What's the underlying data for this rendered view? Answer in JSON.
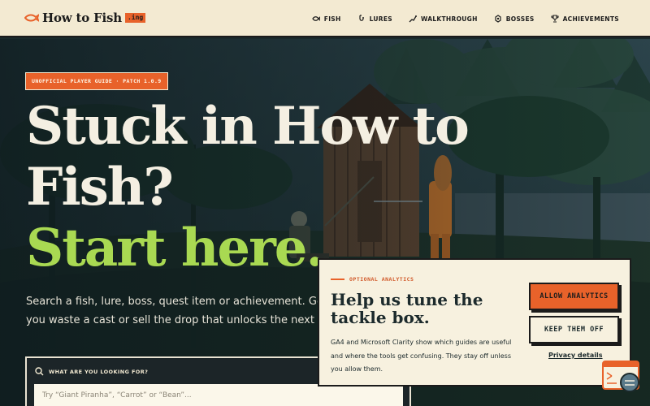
{
  "header": {
    "logo_text": "How to Fish",
    "logo_tld": ".ing",
    "nav": [
      {
        "label": "FISH",
        "icon": "fish-icon"
      },
      {
        "label": "LURES",
        "icon": "lure-icon"
      },
      {
        "label": "WALKTHROUGH",
        "icon": "path-icon"
      },
      {
        "label": "BOSSES",
        "icon": "boss-icon"
      },
      {
        "label": "ACHIEVEMENTS",
        "icon": "trophy-icon"
      }
    ]
  },
  "hero": {
    "badge": "UNOFFICIAL PLAYER GUIDE · PATCH 1.0.9",
    "title_line1": "Stuck in How to",
    "title_line2": "Fish?",
    "title_line3": "Start here.",
    "subtitle_line1": "Search a fish, lure, boss, quest item or achievement. Get the answer",
    "subtitle_line2": "you waste a cast or sell the drop that unlocks the next island.",
    "search_label": "WHAT ARE YOU LOOKING FOR?",
    "search_placeholder": "Try “Giant Piranha”, “Carrot” or “Bean”..."
  },
  "consent": {
    "eyebrow": "OPTIONAL ANALYTICS",
    "title": "Help us tune the tackle box.",
    "body": "GA4 and Microsoft Clarity show which guides are useful and where the tools get confusing. They stay off unless you allow them.",
    "allow_label": "ALLOW ANALYTICS",
    "keep_label": "KEEP THEM OFF",
    "privacy_label": "Privacy details"
  },
  "colors": {
    "accent": "#e8622a",
    "green": "#a9d952",
    "cream": "#f3ead2",
    "dark": "#1c2a2c"
  }
}
